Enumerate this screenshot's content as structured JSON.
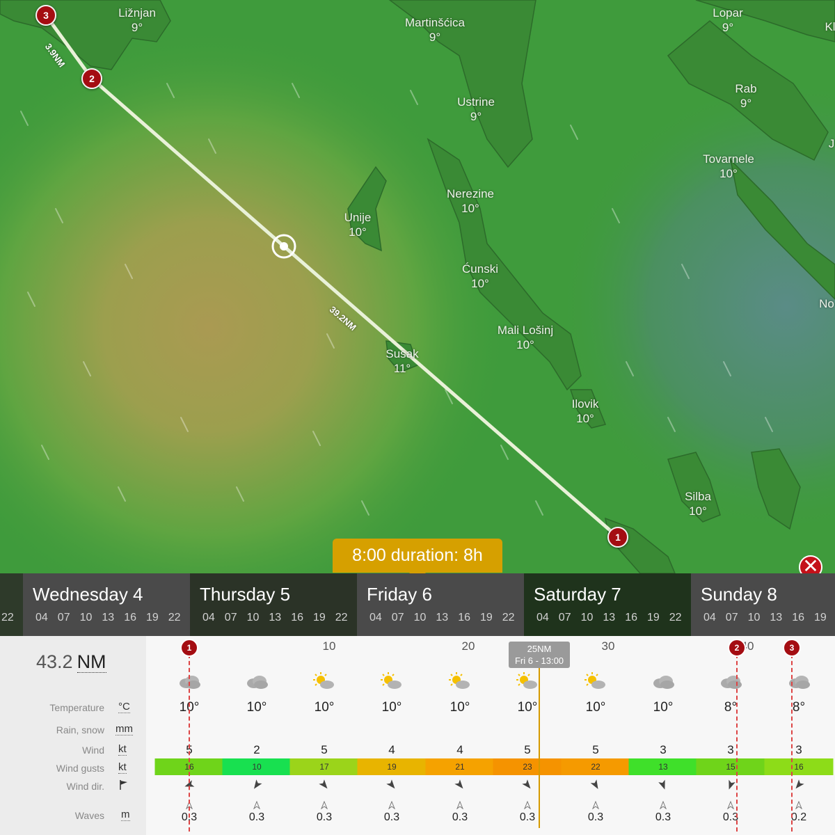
{
  "map": {
    "places": [
      {
        "name": "Ližnjan",
        "temp": "9°"
      },
      {
        "name": "Martinšćica",
        "temp": "9°"
      },
      {
        "name": "Lopar",
        "temp": "9°"
      },
      {
        "name": "Rab",
        "temp": "9°"
      },
      {
        "name": "Ustrine",
        "temp": "9°"
      },
      {
        "name": "Tovarnele",
        "temp": "10°"
      },
      {
        "name": "Nerezine",
        "temp": "10°"
      },
      {
        "name": "Unije",
        "temp": "10°"
      },
      {
        "name": "Ćunski",
        "temp": "10°"
      },
      {
        "name": "Mali Lošinj",
        "temp": "10°"
      },
      {
        "name": "Susak",
        "temp": "11°"
      },
      {
        "name": "Ilovik",
        "temp": "10°"
      },
      {
        "name": "Silba",
        "temp": "10°"
      },
      {
        "name": "No",
        "temp": ""
      },
      {
        "name": "Kl",
        "temp": ""
      },
      {
        "name": "J",
        "temp": ""
      }
    ],
    "route": {
      "markers": [
        "1",
        "2",
        "3"
      ],
      "leg_labels": [
        "39.2NM",
        "3.9NM"
      ]
    }
  },
  "duration_badge": "8:00 duration: 8h",
  "close_label": "✕",
  "timeline": {
    "days": [
      {
        "name": "",
        "hours": [
          "22"
        ]
      },
      {
        "name": "Wednesday 4",
        "hours": [
          "04",
          "07",
          "10",
          "13",
          "16",
          "19",
          "22"
        ]
      },
      {
        "name": "Thursday 5",
        "hours": [
          "04",
          "07",
          "10",
          "13",
          "16",
          "19",
          "22"
        ]
      },
      {
        "name": "Friday 6",
        "hours": [
          "04",
          "07",
          "10",
          "13",
          "16",
          "19",
          "22"
        ]
      },
      {
        "name": "Saturday 7",
        "hours": [
          "04",
          "07",
          "10",
          "13",
          "16",
          "19",
          "22"
        ]
      },
      {
        "name": "Sunday 8",
        "hours": [
          "04",
          "07",
          "10",
          "13",
          "16",
          "19"
        ]
      }
    ]
  },
  "panel": {
    "distance_value": "43.2",
    "distance_unit": "NM",
    "scale": [
      "10",
      "20",
      "30",
      "40"
    ],
    "cursor": {
      "line1": "25NM",
      "line2": "Fri 6 - 13:00"
    },
    "markers": [
      "1",
      "2",
      "3"
    ],
    "rows": [
      {
        "label": "Temperature",
        "unit": "°C"
      },
      {
        "label": "Rain, snow",
        "unit": "mm"
      },
      {
        "label": "Wind",
        "unit": "kt"
      },
      {
        "label": "Wind gusts",
        "unit": "kt"
      },
      {
        "label": "Wind dir.",
        "unit": "flag-icon"
      },
      {
        "label": "Waves",
        "unit": "m"
      }
    ],
    "columns": [
      {
        "weather": "cloudy-icon",
        "temp": "10°",
        "wind": "5",
        "wave": "0.3",
        "dir": 250
      },
      {
        "weather": "cloudy-icon",
        "temp": "10°",
        "wind": "2",
        "wave": "0.3",
        "dir": 215
      },
      {
        "weather": "partly-sunny-icon",
        "temp": "10°",
        "wind": "5",
        "wave": "0.3",
        "dir": 140
      },
      {
        "weather": "partly-sunny-icon",
        "temp": "10°",
        "wind": "4",
        "wave": "0.3",
        "dir": 140
      },
      {
        "weather": "partly-sunny-icon",
        "temp": "10°",
        "wind": "4",
        "wave": "0.3",
        "dir": 140
      },
      {
        "weather": "partly-sunny-icon",
        "temp": "10°",
        "wind": "5",
        "wave": "0.3",
        "dir": 140
      },
      {
        "weather": "partly-sunny-icon",
        "temp": "10°",
        "wind": "5",
        "wave": "0.3",
        "dir": 150
      },
      {
        "weather": "cloudy-icon",
        "temp": "10°",
        "wind": "3",
        "wave": "0.3",
        "dir": 160
      },
      {
        "weather": "cloudy-icon",
        "temp": "8°",
        "wind": "3",
        "wave": "0.3",
        "dir": 200
      },
      {
        "weather": "cloudy-icon",
        "temp": "8°",
        "wind": "3",
        "wave": "0.2",
        "dir": 220
      }
    ],
    "gusts": [
      "16",
      "10",
      "17",
      "19",
      "21",
      "23",
      "22",
      "13",
      "15",
      "16"
    ],
    "gust_colors": [
      "#6fd41a",
      "#18e050",
      "#9bd41a",
      "#e8b400",
      "#f5a200",
      "#f59300",
      "#f59a00",
      "#3fe02a",
      "#6fd41a",
      "#8ddc18"
    ]
  }
}
